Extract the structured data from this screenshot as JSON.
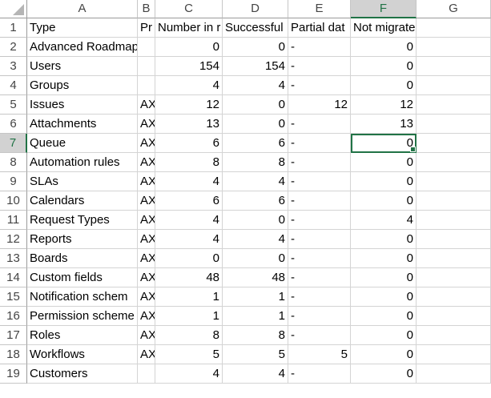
{
  "columns": [
    "A",
    "B",
    "C",
    "D",
    "E",
    "F",
    "G"
  ],
  "active_column": "F",
  "active_row": 7,
  "rows": [
    {
      "num": "1",
      "cells": [
        "Type",
        "Pr",
        "Number in r",
        "Successful",
        "Partial dat",
        "Not migrated",
        ""
      ]
    },
    {
      "num": "2",
      "cells": [
        "Advanced Roadmaps",
        "",
        "0",
        "0",
        "-",
        "0",
        ""
      ]
    },
    {
      "num": "3",
      "cells": [
        "Users",
        "",
        "154",
        "154",
        "-",
        "0",
        ""
      ]
    },
    {
      "num": "4",
      "cells": [
        "Groups",
        "",
        "4",
        "4",
        "-",
        "0",
        ""
      ]
    },
    {
      "num": "5",
      "cells": [
        "Issues",
        "AX",
        "12",
        "0",
        "12",
        "12",
        ""
      ]
    },
    {
      "num": "6",
      "cells": [
        "Attachments",
        "AX",
        "13",
        "0",
        "-",
        "13",
        ""
      ]
    },
    {
      "num": "7",
      "cells": [
        "Queue",
        "AX",
        "6",
        "6",
        "-",
        "0",
        ""
      ]
    },
    {
      "num": "8",
      "cells": [
        "Automation rules",
        "AX",
        "8",
        "8",
        "-",
        "0",
        ""
      ]
    },
    {
      "num": "9",
      "cells": [
        "SLAs",
        "AX",
        "4",
        "4",
        "-",
        "0",
        ""
      ]
    },
    {
      "num": "10",
      "cells": [
        "Calendars",
        "AX",
        "6",
        "6",
        "-",
        "0",
        ""
      ]
    },
    {
      "num": "11",
      "cells": [
        "Request Types",
        "AX",
        "4",
        "0",
        "-",
        "4",
        ""
      ]
    },
    {
      "num": "12",
      "cells": [
        "Reports",
        "AX",
        "4",
        "4",
        "-",
        "0",
        ""
      ]
    },
    {
      "num": "13",
      "cells": [
        "Boards",
        "AX",
        "0",
        "0",
        "-",
        "0",
        ""
      ]
    },
    {
      "num": "14",
      "cells": [
        "Custom fields",
        "AX",
        "48",
        "48",
        "-",
        "0",
        ""
      ]
    },
    {
      "num": "15",
      "cells": [
        "Notification schem",
        "AX",
        "1",
        "1",
        "-",
        "0",
        ""
      ]
    },
    {
      "num": "16",
      "cells": [
        "Permission scheme",
        "AX",
        "1",
        "1",
        "-",
        "0",
        ""
      ]
    },
    {
      "num": "17",
      "cells": [
        "Roles",
        "AX",
        "8",
        "8",
        "-",
        "0",
        ""
      ]
    },
    {
      "num": "18",
      "cells": [
        "Workflows",
        "AX",
        "5",
        "5",
        "5",
        "0",
        ""
      ]
    },
    {
      "num": "19",
      "cells": [
        "Customers",
        "",
        "4",
        "4",
        "-",
        "0",
        ""
      ]
    }
  ]
}
